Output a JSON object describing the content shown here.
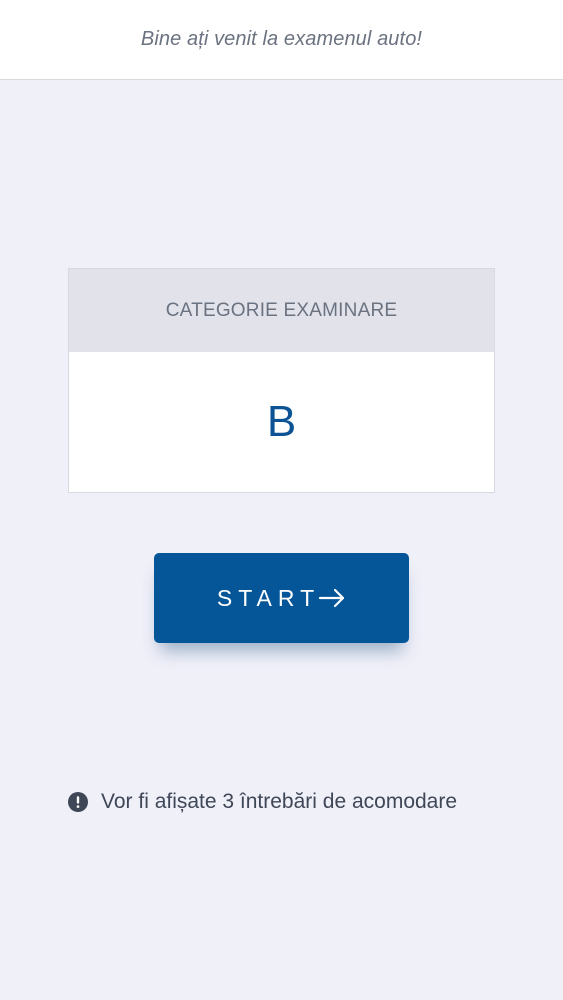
{
  "header": {
    "welcome_text": "Bine ați venit la examenul auto!"
  },
  "category_card": {
    "heading": "CATEGORIE EXAMINARE",
    "value": "B"
  },
  "start_button": {
    "label": "START",
    "icon": "arrow-right-icon"
  },
  "notice": {
    "icon": "exclamation-circle-icon",
    "text": "Vor fi afișate 3 întrebări de acomodare"
  },
  "colors": {
    "background": "#f0f0f9",
    "primary": "#045698",
    "card_header": "#e1e2ea",
    "muted_text": "#6b7280"
  }
}
